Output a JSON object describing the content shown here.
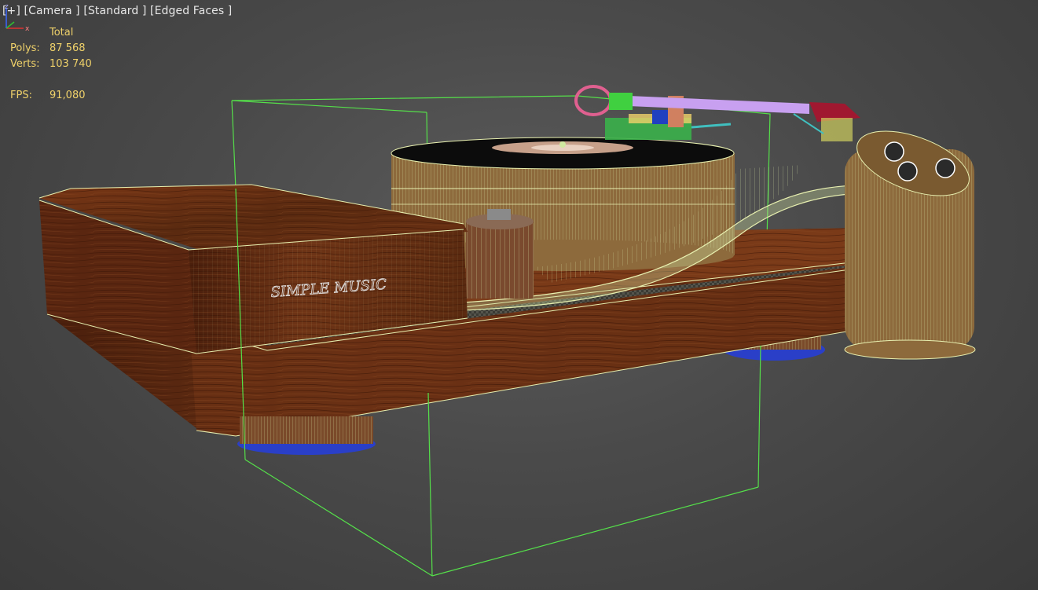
{
  "viewport": {
    "label_parts": [
      "[+]",
      "[Camera ]",
      "[Standard ]",
      "[Edged Faces ]"
    ]
  },
  "stats": {
    "header": "Total",
    "polys_label": "Polys:",
    "polys_value": "87 568",
    "verts_label": "Verts:",
    "verts_value": "103 740",
    "fps_label": "FPS:",
    "fps_value": "91,080"
  },
  "scene": {
    "logo_text": "SIMPLE MUSIC",
    "colors": {
      "background": "#4a4a4a",
      "selection_box": "#55e04a",
      "wood": "#6b2f12",
      "wireframe": "#e8f0b0",
      "platter_edge": "#8d6a3c",
      "feet_ring": "#2a3fc8",
      "tonearm": "#c8a0f0",
      "counterweight": "#e06090",
      "headshell": "#a01830",
      "label_text": "#f0d26a"
    }
  },
  "gizmo": {
    "z_label": "z",
    "x_label": "x"
  }
}
